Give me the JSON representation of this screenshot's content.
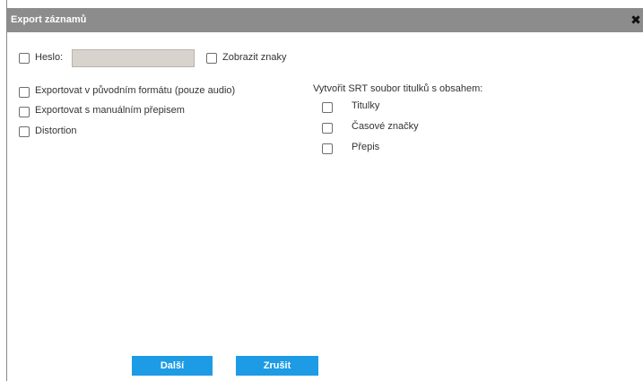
{
  "dialog": {
    "title": "Export záznamů",
    "close_icon": "close-icon",
    "close_glyph": "✖"
  },
  "password": {
    "label": "Heslo:",
    "value": "",
    "show_chars_label": "Zobrazit znaky"
  },
  "options": [
    {
      "label": "Exportovat v původním formátu (pouze audio)",
      "checked": false
    },
    {
      "label": "Exportovat s manuálním přepisem",
      "checked": false
    },
    {
      "label": "Distortion",
      "checked": false
    }
  ],
  "srt": {
    "heading": "Vytvořit SRT soubor titulků s obsahem:",
    "items": [
      {
        "label": "Titulky",
        "checked": false
      },
      {
        "label": "Časové značky",
        "checked": false
      },
      {
        "label": "Přepis",
        "checked": false
      }
    ]
  },
  "buttons": {
    "next_label": "Další",
    "cancel_label": "Zrušit"
  },
  "colors": {
    "titlebar": "#8c8c8c",
    "button": "#1e9be5",
    "input_bg": "#d8d3cd"
  }
}
